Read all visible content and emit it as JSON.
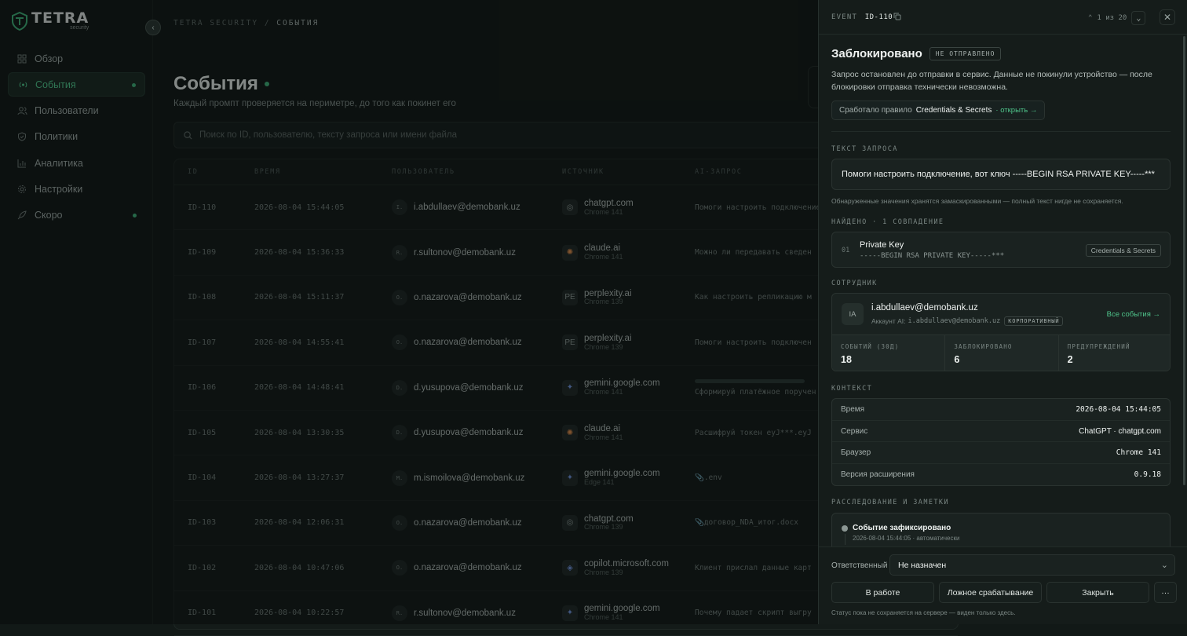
{
  "brand": {
    "title": "TETRA",
    "sub": "security"
  },
  "nav": [
    {
      "label": "Обзор",
      "icon": "grid-icon",
      "active": false,
      "dot": false
    },
    {
      "label": "События",
      "icon": "radar-icon",
      "active": true,
      "dot": true
    },
    {
      "label": "Пользователи",
      "icon": "users-icon",
      "active": false,
      "dot": false
    },
    {
      "label": "Политики",
      "icon": "shield-icon",
      "active": false,
      "dot": false
    },
    {
      "label": "Аналитика",
      "icon": "chart-icon",
      "active": false,
      "dot": false
    },
    {
      "label": "Настройки",
      "icon": "gear-icon",
      "active": false,
      "dot": false
    },
    {
      "label": "Скоро",
      "icon": "rocket-icon",
      "active": false,
      "dot": true
    }
  ],
  "breadcrumb": {
    "root": "TETRA SECURITY",
    "sep": "/",
    "current": "СОБЫТИЯ"
  },
  "page": {
    "title": "События",
    "subtitle": "Каждый промпт проверяется на периметре, до того как покинет его",
    "search_placeholder": "Поиск по ID, пользователю, тексту запроса или имени файла"
  },
  "table": {
    "headers": [
      "ID",
      "ВРЕМЯ",
      "ПОЛЬЗОВАТЕЛЬ",
      "ИСТОЧНИК",
      "AI-ЗАПРОС"
    ],
    "rows": [
      {
        "id": "ID-110",
        "time": "2026-08-04 15:44:05",
        "av": "I.",
        "user": "i.abdullaev@demobank.uz",
        "src_icon": "chatgpt-icon",
        "src_glyph": "◎",
        "src": "chatgpt.com",
        "browser": "Chrome 141",
        "req": "Помоги настроить подключение"
      },
      {
        "id": "ID-109",
        "time": "2026-08-04 15:36:33",
        "av": "R.",
        "user": "r.sultonov@demobank.uz",
        "src_icon": "claude-icon",
        "src_glyph": "✺",
        "src": "claude.ai",
        "browser": "Chrome 141",
        "req": "Можно ли передавать сведен"
      },
      {
        "id": "ID-108",
        "time": "2026-08-04 15:11:37",
        "av": "O.",
        "user": "o.nazarova@demobank.uz",
        "src_icon": "perplexity-icon",
        "src_glyph": "PE",
        "src": "perplexity.ai",
        "browser": "Chrome 139",
        "req": "Как настроить репликацию м"
      },
      {
        "id": "ID-107",
        "time": "2026-08-04 14:55:41",
        "av": "O.",
        "user": "o.nazarova@demobank.uz",
        "src_icon": "perplexity-icon",
        "src_glyph": "PE",
        "src": "perplexity.ai",
        "browser": "Chrome 139",
        "req": "Помоги настроить подключен"
      },
      {
        "id": "ID-106",
        "time": "2026-08-04 14:48:41",
        "av": "D.",
        "user": "d.yusupova@demobank.uz",
        "src_icon": "gemini-icon",
        "src_glyph": "✦",
        "src": "gemini.google.com",
        "browser": "Chrome 141",
        "req": "Сформируй платёжное поручен"
      },
      {
        "id": "ID-105",
        "time": "2026-08-04 13:30:35",
        "av": "D.",
        "user": "d.yusupova@demobank.uz",
        "src_icon": "claude-icon",
        "src_glyph": "✺",
        "src": "claude.ai",
        "browser": "Chrome 141",
        "req": "Расшифруй токен eyJ***.eyJ"
      },
      {
        "id": "ID-104",
        "time": "2026-08-04 13:27:37",
        "av": "M.",
        "user": "m.ismoilova@demobank.uz",
        "src_icon": "gemini-icon",
        "src_glyph": "✦",
        "src": "gemini.google.com",
        "browser": "Edge 141",
        "req": "📎.env"
      },
      {
        "id": "ID-103",
        "time": "2026-08-04 12:06:31",
        "av": "O.",
        "user": "o.nazarova@demobank.uz",
        "src_icon": "chatgpt-icon",
        "src_glyph": "◎",
        "src": "chatgpt.com",
        "browser": "Chrome 139",
        "req": "📎договор_NDA_итог.docx"
      },
      {
        "id": "ID-102",
        "time": "2026-08-04 10:47:06",
        "av": "O.",
        "user": "o.nazarova@demobank.uz",
        "src_icon": "copilot-icon",
        "src_glyph": "◈",
        "src": "copilot.microsoft.com",
        "browser": "Chrome 139",
        "req": "Клиент прислал данные карт"
      },
      {
        "id": "ID-101",
        "time": "2026-08-04 10:22:57",
        "av": "R.",
        "user": "r.sultonov@demobank.uz",
        "src_icon": "gemini-icon",
        "src_glyph": "✦",
        "src": "gemini.google.com",
        "browser": "Chrome 141",
        "req": "Почему падает скрипт выгру"
      }
    ]
  },
  "panel": {
    "event_label": "EVENT",
    "event_id": "ID-110",
    "pager": "1 из 20",
    "status_title": "Заблокировано",
    "status_badge": "НЕ ОТПРАВЛЕНО",
    "description": "Запрос остановлен до отправки в сервис. Данные не покинули устройство — после блокировки отправка технически невозможна.",
    "rule_label": "Сработало правило",
    "rule_name": "Credentials & Secrets",
    "rule_link": "· открыть →",
    "request_section": "ТЕКСТ ЗАПРОСА",
    "request_text": "Помоги настроить подключение, вот ключ -----BEGIN RSA PRIVATE KEY-----***",
    "request_note": "Обнаруженные значения хранятся замаскированными — полный текст нигде не сохраняется.",
    "found_section": "НАЙДЕНО · 1 СОВПАДЕНИЕ",
    "finding": {
      "num": "01",
      "name": "Private Key",
      "value": "-----BEGIN RSA PRIVATE KEY-----***",
      "tag": "Credentials & Secrets"
    },
    "employee_section": "СОТРУДНИК",
    "employee": {
      "initials": "IA",
      "email": "i.abdullaev@demobank.uz",
      "account_label": "Аккаунт AI:",
      "account": "i.abdullaev@demobank.uz",
      "account_type": "КОРПОРАТИВНЫЙ",
      "link": "Все события →",
      "stats": [
        {
          "label": "СОБЫТИЙ (30Д)",
          "value": "18"
        },
        {
          "label": "ЗАБЛОКИРОВАНО",
          "value": "6"
        },
        {
          "label": "ПРЕДУПРЕЖДЕНИЙ",
          "value": "2"
        }
      ]
    },
    "context_section": "КОНТЕКСТ",
    "context": [
      {
        "k": "Время",
        "v": "2026-08-04 15:44:05",
        "mono": true
      },
      {
        "k": "Сервис",
        "v": "ChatGPT · chatgpt.com",
        "mono": false
      },
      {
        "k": "Браузер",
        "v": "Chrome 141",
        "mono": true
      },
      {
        "k": "Версия расширения",
        "v": "0.9.18",
        "mono": true
      }
    ],
    "investigation_section": "РАССЛЕДОВАНИЕ И ЗАМЕТКИ",
    "investigation": {
      "title": "Событие зафиксировано",
      "meta": "2026-08-04 15:44:05 · автоматически"
    },
    "assignee_label": "Ответственный",
    "assignee_value": "Не назначен",
    "buttons": {
      "in_work": "В работе",
      "false_positive": "Ложное срабатывание",
      "close": "Закрыть",
      "more": "···"
    },
    "footer_note": "Статус пока не сохраняется на сервере — виден только здесь."
  },
  "colors": {
    "accent": "#4fc58b",
    "bg": "#121917",
    "panel": "#151c1a"
  }
}
